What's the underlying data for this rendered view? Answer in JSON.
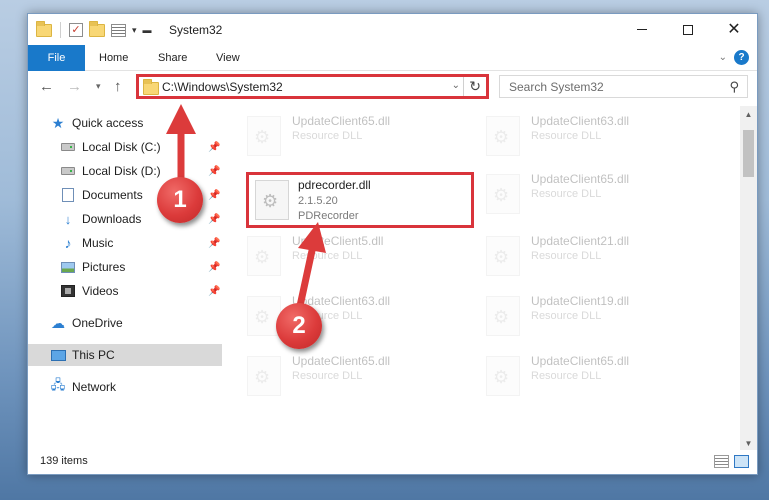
{
  "window": {
    "title": "System32"
  },
  "ribbon": {
    "tabs": [
      {
        "label": "File"
      },
      {
        "label": "Home"
      },
      {
        "label": "Share"
      },
      {
        "label": "View"
      }
    ]
  },
  "address": {
    "path": "C:\\Windows\\System32"
  },
  "search": {
    "placeholder": "Search System32"
  },
  "sidebar": {
    "items": [
      {
        "label": "Quick access",
        "icon": "star-icon"
      },
      {
        "label": "Local Disk (C:)",
        "icon": "drive-icon",
        "pinned": true
      },
      {
        "label": "Local Disk (D:)",
        "icon": "drive-icon",
        "pinned": true
      },
      {
        "label": "Documents",
        "icon": "documents-icon",
        "pinned": true
      },
      {
        "label": "Downloads",
        "icon": "downloads-icon",
        "pinned": true
      },
      {
        "label": "Music",
        "icon": "music-icon",
        "pinned": true
      },
      {
        "label": "Pictures",
        "icon": "pictures-icon",
        "pinned": true
      },
      {
        "label": "Videos",
        "icon": "videos-icon",
        "pinned": true
      },
      {
        "label": "OneDrive",
        "icon": "cloud-icon"
      },
      {
        "label": "This PC",
        "icon": "computer-icon",
        "selected": true
      },
      {
        "label": "Network",
        "icon": "network-icon"
      }
    ]
  },
  "files": [
    {
      "name": "UpdateClient65.dll",
      "type": "Resource DLL"
    },
    {
      "name": "UpdateClient63.dll",
      "type": "Resource DLL"
    },
    {
      "name": "pdrecorder.dll",
      "type": "2.1.5.20",
      "desc": "PDRecorder"
    },
    {
      "name": "UpdateClient65.dll",
      "type": "Resource DLL"
    },
    {
      "name": "UpdateClient5.dll",
      "type": "Resource DLL"
    },
    {
      "name": "UpdateClient21.dll",
      "type": "Resource DLL"
    },
    {
      "name": "UpdateClient63.dll",
      "type": "Resource DLL"
    },
    {
      "name": "UpdateClient19.dll",
      "type": "Resource DLL"
    },
    {
      "name": "UpdateClient65.dll",
      "type": "Resource DLL"
    },
    {
      "name": "UpdateClient65.dll",
      "type": "Resource DLL"
    }
  ],
  "status": {
    "count": "139 items"
  },
  "annotations": {
    "badge_1": "1",
    "badge_2": "2",
    "color": "#d9343b"
  }
}
